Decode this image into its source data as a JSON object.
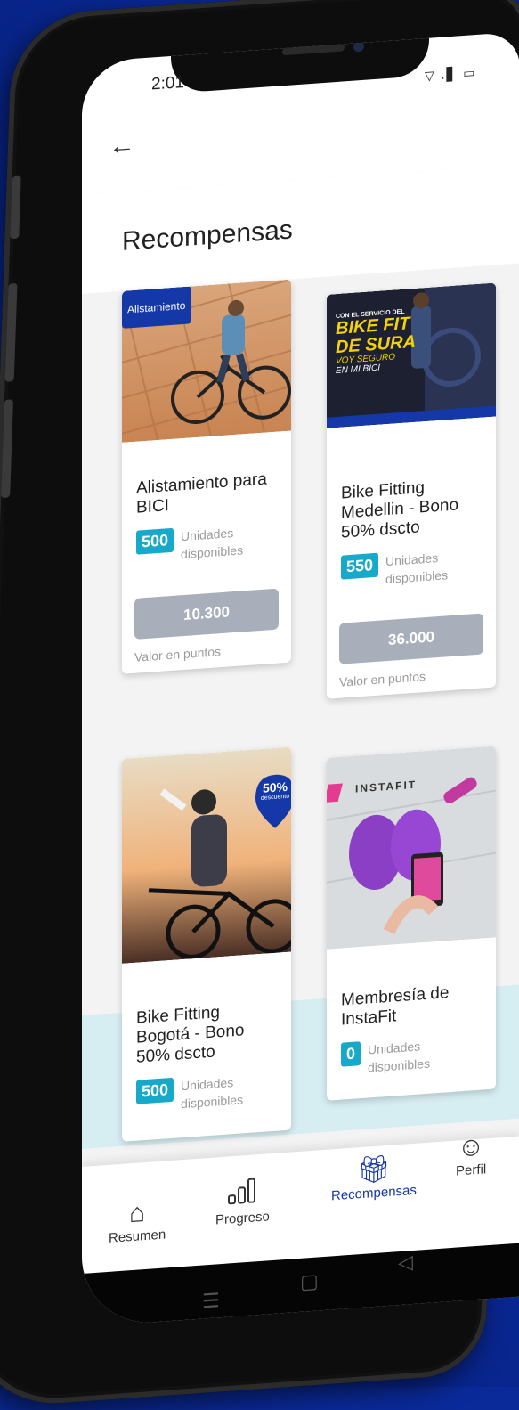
{
  "status": {
    "time": "2:01",
    "icons": "▽ .▋ ▭"
  },
  "header": {
    "title": "Recompensas"
  },
  "cards": [
    {
      "image_tag": "Alistamiento",
      "title": "Alistamiento para BICI",
      "units": "500",
      "units_label": "Unidades disponibles",
      "price": "10.300",
      "price_caption": "Valor en puntos"
    },
    {
      "banner_lines": [
        "CON EL SERVICIO DEL",
        "BIKE FIT",
        "DE SURA",
        "VOY SEGURO",
        "EN MI BICI"
      ],
      "title": "Bike Fitting Medellin - Bono 50% dscto",
      "units": "550",
      "units_label": "Unidades disponibles",
      "price": "36.000",
      "price_caption": "Valor en puntos"
    },
    {
      "badge_main": "50%",
      "badge_sub": "descuento",
      "title": "Bike Fitting Bogotá - Bono 50% dscto",
      "units": "500",
      "units_label": "Unidades disponibles"
    },
    {
      "logo_text": "INSTAFIT",
      "title": "Membresía de InstaFit",
      "units": "0",
      "units_label": "Unidades disponibles"
    }
  ],
  "tabs": [
    {
      "label": "Resumen",
      "icon": "home-heart-icon",
      "active": false
    },
    {
      "label": "Progreso",
      "icon": "bar-chart-icon",
      "active": false
    },
    {
      "label": "Recompensas",
      "icon": "gift-icon",
      "active": true
    },
    {
      "label": "Perfil",
      "icon": "user-icon",
      "active": false
    }
  ],
  "colors": {
    "accent": "#17a9c9",
    "brand": "#1538a8",
    "button": "#a9aebb",
    "background": "#0a2a9a"
  }
}
